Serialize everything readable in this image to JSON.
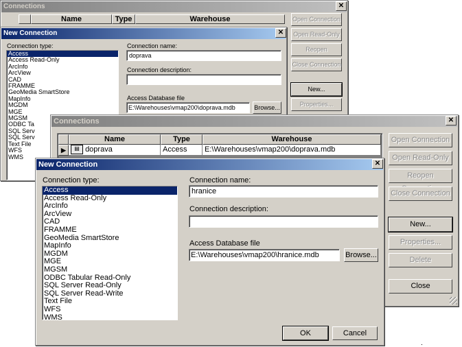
{
  "back_connections": {
    "title": "Connections",
    "col_name": "Name",
    "col_type": "Type",
    "col_warehouse": "Warehouse",
    "buttons": {
      "open": "Open Connection",
      "open_ro": "Open Read-Only",
      "reopen": "Reopen Connection",
      "close": "Close Connection",
      "new": "New...",
      "properties": "Properties..."
    }
  },
  "back_new_connection": {
    "title": "New Connection",
    "type_label": "Connection type:",
    "types": [
      "Access",
      "Access Read-Only",
      "ArcInfo",
      "ArcView",
      "CAD",
      "FRAMME",
      "GeoMedia SmartStore",
      "MapInfo",
      "MGDM",
      "MGE",
      "MGSM",
      "ODBC Ta",
      "SQL Serv",
      "SQL Serv",
      "Text File",
      "WFS",
      "WMS"
    ],
    "name_label": "Connection name:",
    "name_value": "doprava",
    "desc_label": "Connection description:",
    "file_label": "Access Database file",
    "file_value": "E:\\Warehouses\\vmap200\\doprava.mdb",
    "browse": "Browse..."
  },
  "front_connections": {
    "title": "Connections",
    "col_name": "Name",
    "col_type": "Type",
    "col_warehouse": "Warehouse",
    "row": {
      "name": "doprava",
      "type": "Access",
      "warehouse": "E:\\Warehouses\\vmap200\\doprava.mdb"
    },
    "buttons": {
      "open": "Open Connection",
      "open_ro": "Open Read-Only",
      "reopen": "Reopen Connection",
      "close_conn": "Close Connection",
      "new": "New...",
      "properties": "Properties...",
      "delete": "Delete",
      "close": "Close"
    }
  },
  "front_new_connection": {
    "title": "New Connection",
    "type_label": "Connection type:",
    "types": [
      "Access",
      "Access Read-Only",
      "ArcInfo",
      "ArcView",
      "CAD",
      "FRAMME",
      "GeoMedia SmartStore",
      "MapInfo",
      "MGDM",
      "MGE",
      "MGSM",
      "ODBC Tabular Read-Only",
      "SQL Server Read-Only",
      "SQL Server Read-Write",
      "Text File",
      "WFS",
      "WMS"
    ],
    "name_label": "Connection name:",
    "name_value": "hranice",
    "desc_label": "Connection description:",
    "file_label": "Access Database file",
    "file_value": "E:\\Warehouses\\vmap200\\hranice.mdb",
    "browse": "Browse...",
    "ok": "OK",
    "cancel": "Cancel"
  }
}
